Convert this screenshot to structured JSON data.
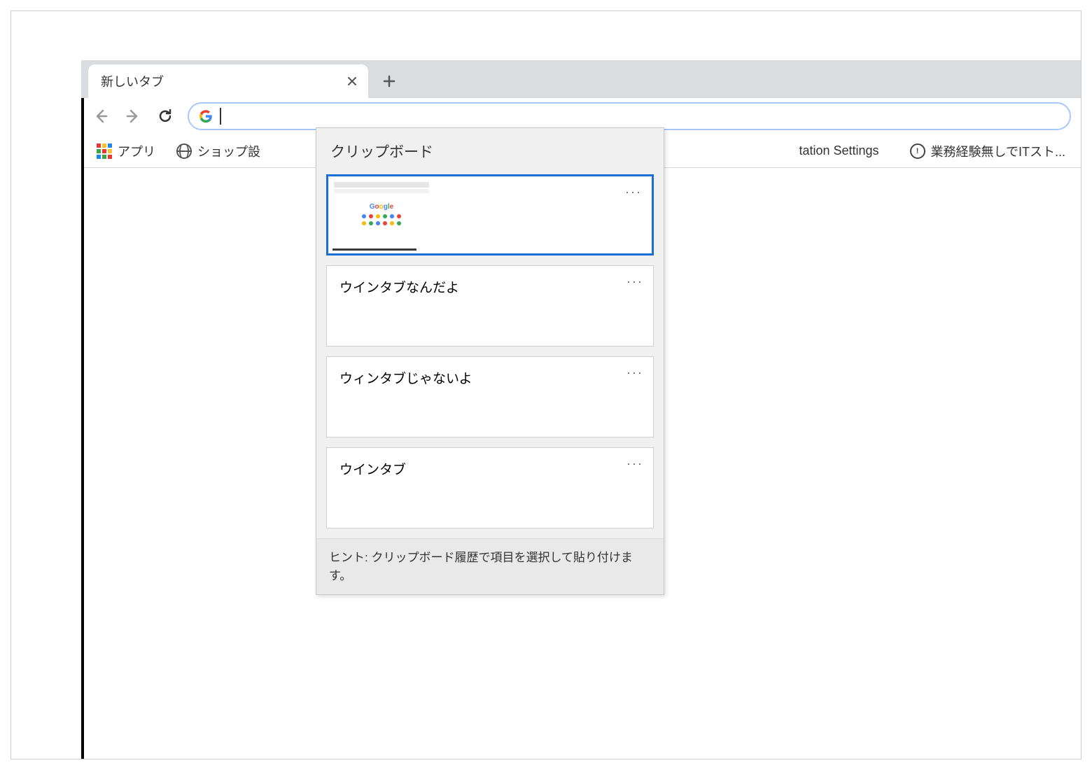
{
  "tab": {
    "title": "新しいタブ"
  },
  "bookmarks": {
    "apps": "アプリ",
    "shop": "ショップ設",
    "right1": "tation Settings",
    "right2": "業務経験無しでITスト..."
  },
  "clipboard": {
    "title": "クリップボード",
    "items": [
      {
        "type": "image",
        "thumb_logo": "Google"
      },
      {
        "type": "text",
        "text": "ウインタブなんだよ"
      },
      {
        "type": "text",
        "text": "ウィンタブじゃないよ"
      },
      {
        "type": "text",
        "text": "ウインタブ"
      }
    ],
    "hint": "ヒント: クリップボード履歴で項目を選択して貼り付けます。"
  },
  "icons": {
    "kebab": "···"
  }
}
